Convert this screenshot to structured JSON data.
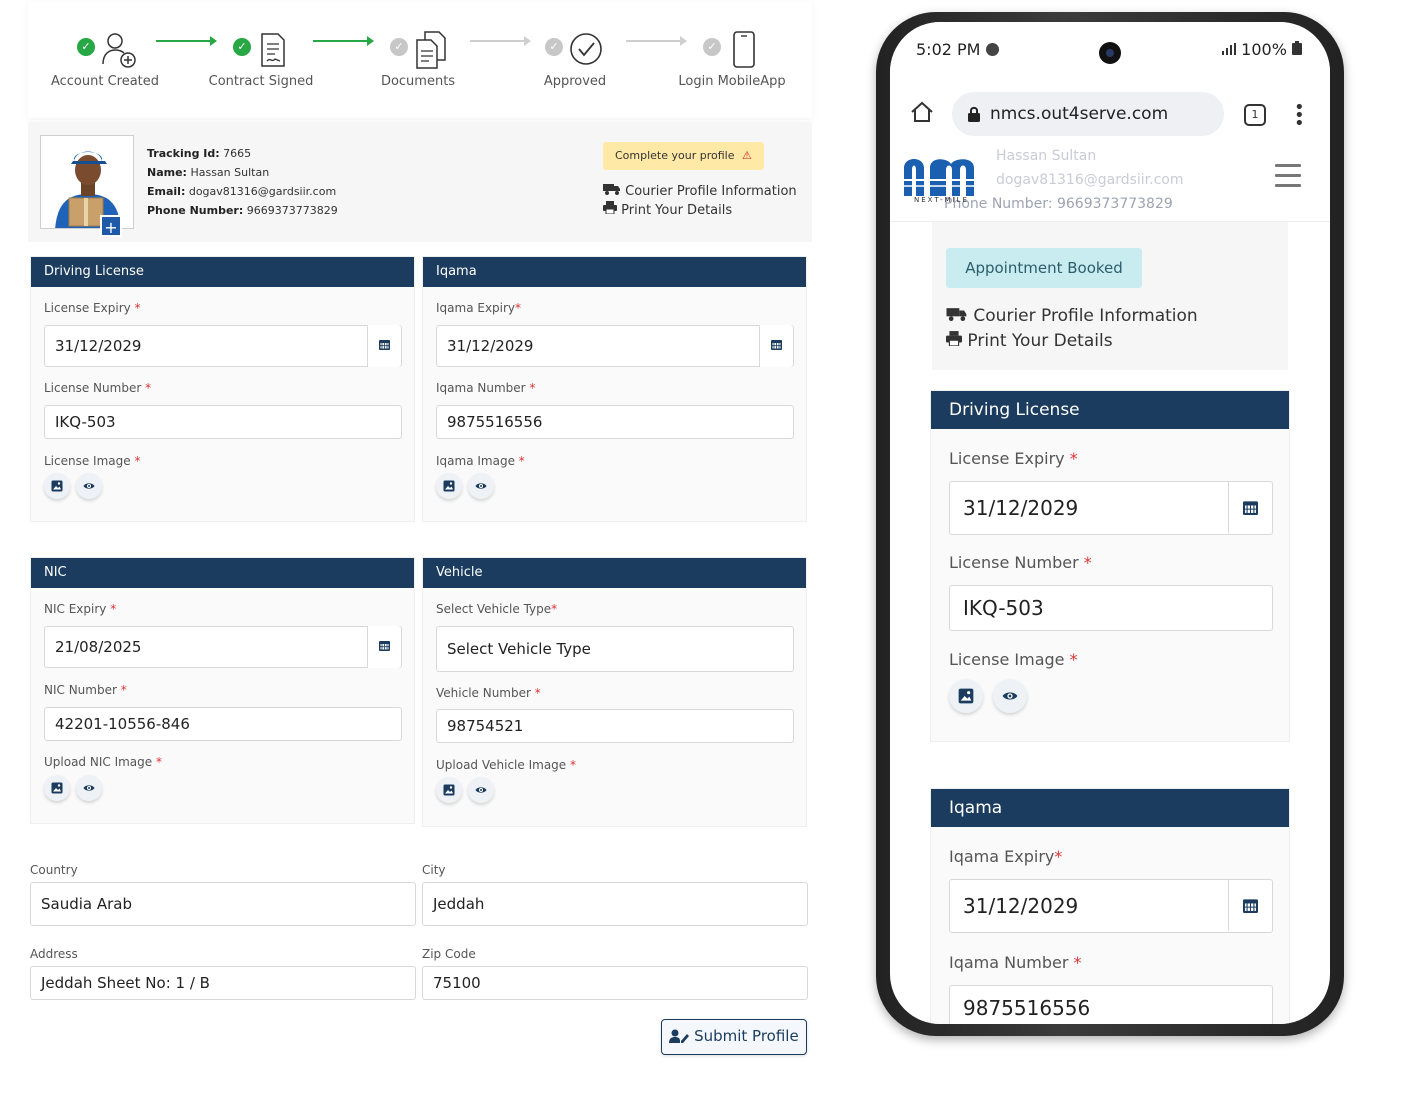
{
  "stepper": {
    "steps": [
      {
        "label": "Account Created",
        "status": "done",
        "icon": "user-plus-icon"
      },
      {
        "label": "Contract Signed",
        "status": "done",
        "icon": "contract-icon"
      },
      {
        "label": "Documents",
        "status": "pending",
        "icon": "documents-icon"
      },
      {
        "label": "Approved",
        "status": "pending",
        "icon": "approved-badge-icon"
      },
      {
        "label": "Login MobileApp",
        "status": "pending",
        "icon": "mobile-icon"
      }
    ]
  },
  "profile": {
    "tracking_label": "Tracking Id:",
    "tracking_value": "7665",
    "name_label": "Name:",
    "name_value": "Hassan Sultan",
    "email_label": "Email:",
    "email_value": "dogav81316@gardsiir.com",
    "phone_label": "Phone Number:",
    "phone_value": "9669373773829",
    "avatar_add": "+",
    "warning_badge": "Complete your profile",
    "warning_icon": "⚠",
    "courier_link": "Courier Profile Information",
    "print_link": "Print Your Details"
  },
  "driving_license": {
    "title": "Driving License",
    "expiry_label": "License Expiry",
    "expiry_value": "31/12/2029",
    "number_label": "License Number",
    "number_value": "IKQ-503",
    "image_label": "License Image"
  },
  "iqama": {
    "title": "Iqama",
    "expiry_label": "Iqama Expiry",
    "expiry_value": "31/12/2029",
    "number_label": "Iqama Number",
    "number_value": "9875516556",
    "image_label": "Iqama Image"
  },
  "nic": {
    "title": "NIC",
    "expiry_label": "NIC Expiry",
    "expiry_value": "21/08/2025",
    "number_label": "NIC Number",
    "number_value": "42201-10556-846",
    "image_label": "Upload NIC Image"
  },
  "vehicle": {
    "title": "Vehicle",
    "type_label": "Select Vehicle Type",
    "type_value": "Select Vehicle Type",
    "number_label": "Vehicle Number",
    "number_value": "98754521",
    "image_label": "Upload Vehicle Image"
  },
  "address": {
    "country_label": "Country",
    "country_value": "Saudia Arab",
    "city_label": "City",
    "city_value": "Jeddah",
    "address_label": "Address",
    "address_value": "Jeddah Sheet No: 1 / B",
    "zip_label": "Zip Code",
    "zip_value": "75100"
  },
  "submit_label": "Submit Profile",
  "required_mark": "*",
  "phone": {
    "time": "5:02 PM",
    "battery": "100%",
    "url": "nmcs.out4serve.com",
    "tab_count": "1",
    "ghost_name": "Hassan Sultan",
    "ghost_email": "dogav81316@gardsiir.com",
    "ghost_phone": "Phone Number: 9669373773829",
    "logo_text": "nm",
    "logo_tagline": "NEXT-MILE",
    "appointment_badge": "Appointment Booked",
    "courier_link": "Courier Profile Information",
    "print_link": "Print Your Details",
    "driving_license": {
      "title": "Driving License",
      "expiry_label": "License Expiry",
      "expiry_value": "31/12/2029",
      "number_label": "License Number",
      "number_value": "IKQ-503",
      "image_label": "License Image"
    },
    "iqama": {
      "title": "Iqama",
      "expiry_label": "Iqama Expiry",
      "expiry_value": "31/12/2029",
      "number_label": "Iqama Number",
      "number_value": "9875516556"
    }
  },
  "colors": {
    "panel_header": "#1b3c5e",
    "success": "#28a745",
    "warning_bg": "#ffe9a6",
    "appointment_bg": "#c9ecf0"
  }
}
